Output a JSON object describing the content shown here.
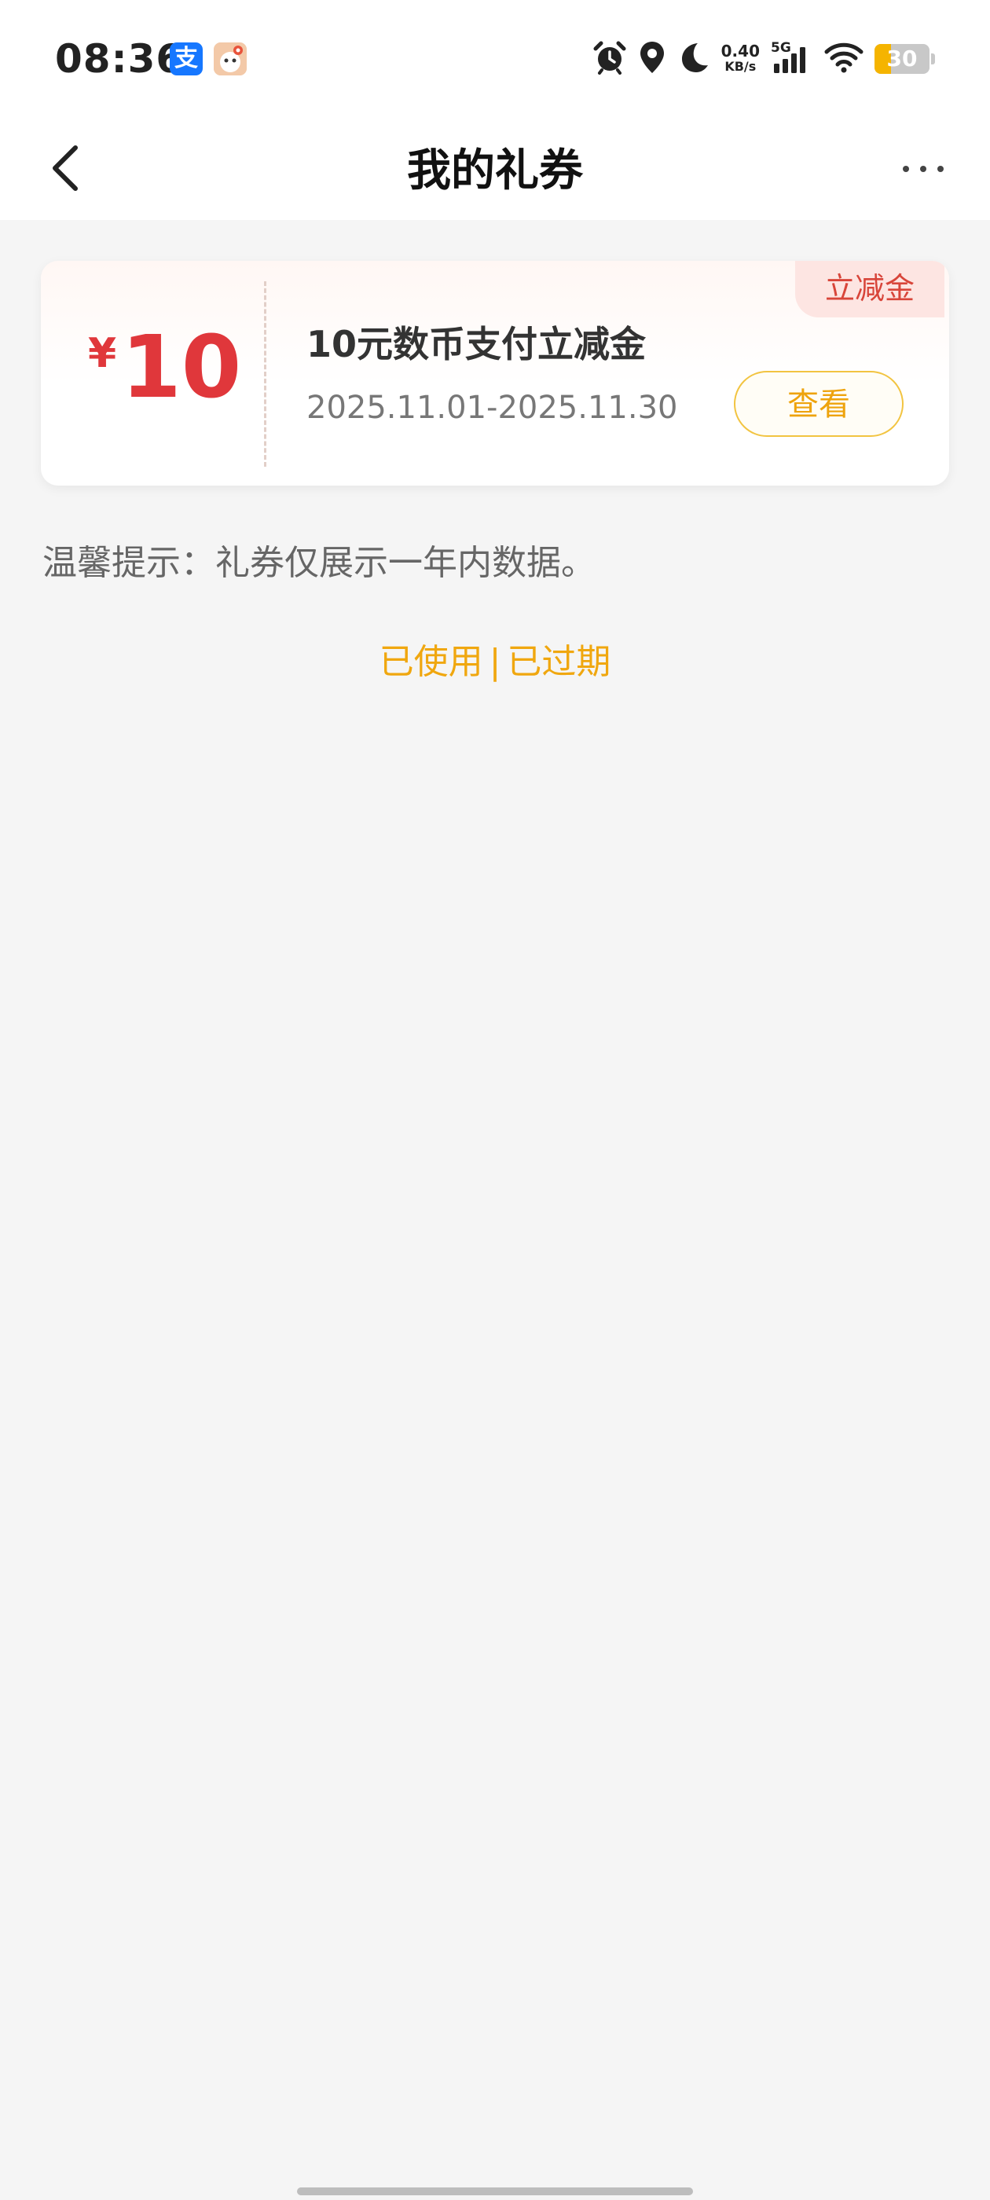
{
  "status_bar": {
    "time": "08:36",
    "alipay_icon_char": "支",
    "net_speed_value": "0.40",
    "net_speed_unit": "KB/s",
    "network_type": "5G",
    "battery_level": "30",
    "battery_fraction": 0.3,
    "icons": [
      "alarm-icon",
      "location-icon",
      "moon-icon",
      "signal-icon",
      "wifi-icon",
      "battery-icon"
    ]
  },
  "nav": {
    "title": "我的礼券",
    "back_icon": "chevron-left-icon",
    "more_icon": "more-dots-icon"
  },
  "coupon": {
    "currency": "¥",
    "amount": "10",
    "name": "10元数币支付立减金",
    "validity": "2025.11.01-2025.11.30",
    "tag": "立减金",
    "view_label": "查看"
  },
  "tip": "温馨提示：礼券仅展示一年内数据。",
  "links": {
    "used": "已使用",
    "separator": "|",
    "expired": "已过期"
  },
  "colors": {
    "accent_red": "#e0373b",
    "accent_orange": "#f0a70f",
    "background": "#f5f5f5",
    "battery_yellow": "#f5b400"
  }
}
